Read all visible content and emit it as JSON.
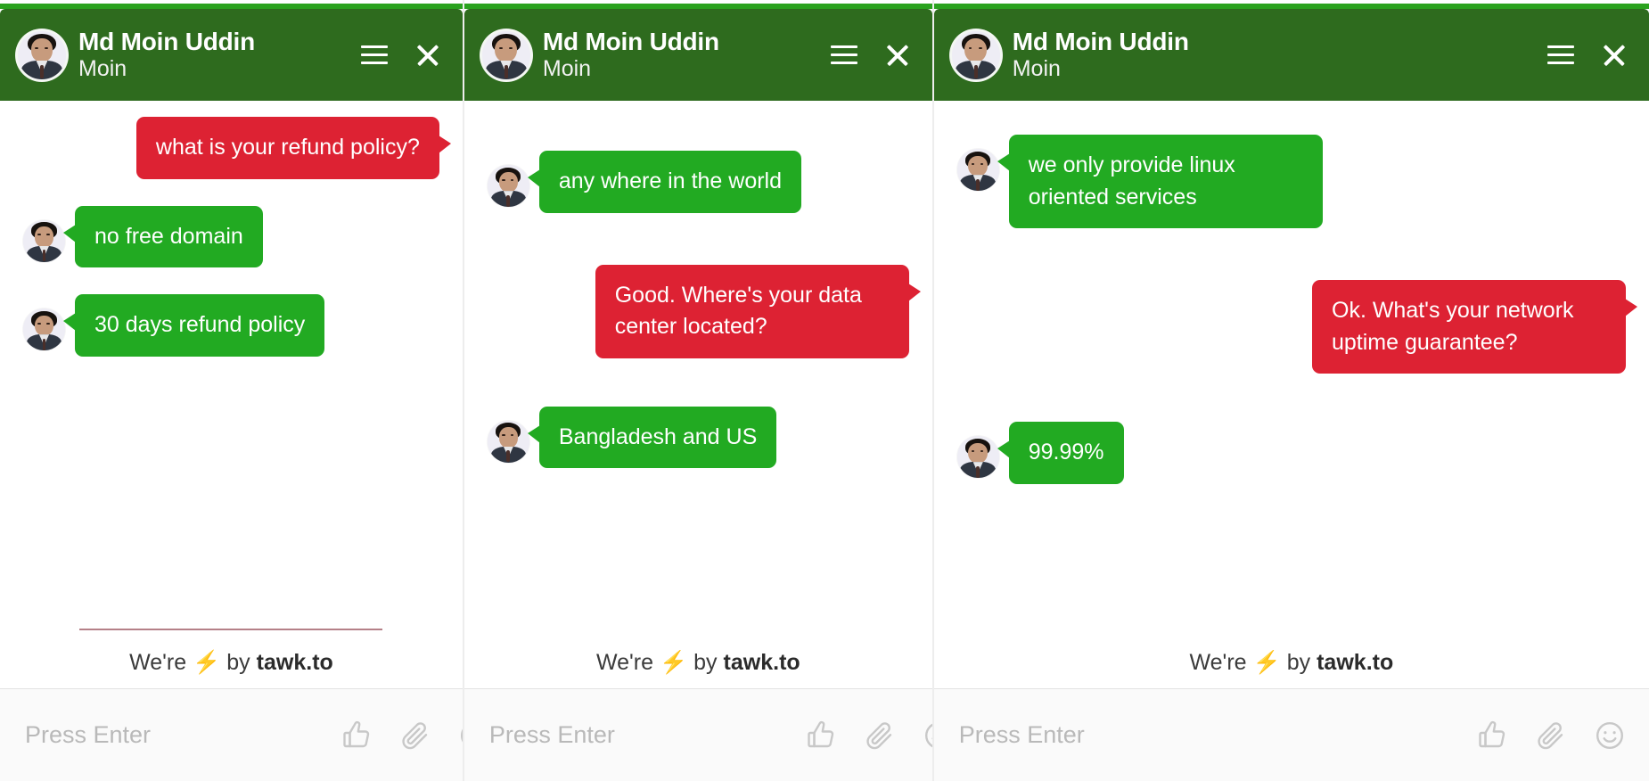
{
  "panels": [
    {
      "header": {
        "name": "Md Moin Uddin",
        "subtitle": "Moin",
        "menu_icon": "hamburger-menu-icon",
        "close_icon": "close-icon"
      },
      "messages": [
        {
          "sender": "visitor",
          "color": "red",
          "text": "what is your refund policy?"
        },
        {
          "sender": "agent",
          "color": "green",
          "text": "no free domain"
        },
        {
          "sender": "agent",
          "color": "green",
          "text": "30 days refund policy"
        }
      ],
      "branding": {
        "prefix": "We're",
        "bolt": "⚡",
        "middle": "by",
        "brand": "tawk.to"
      },
      "composer": {
        "placeholder": "Press Enter",
        "value": "",
        "icons": [
          "thumbs-up-icon",
          "paperclip-icon",
          "emoji-smiley-icon"
        ]
      }
    },
    {
      "header": {
        "name": "Md Moin Uddin",
        "subtitle": "Moin",
        "menu_icon": "hamburger-menu-icon",
        "close_icon": "close-icon"
      },
      "messages": [
        {
          "sender": "agent",
          "color": "green",
          "text": "any where in the world"
        },
        {
          "sender": "visitor",
          "color": "red",
          "text": "Good. Where's your data center located?"
        },
        {
          "sender": "agent",
          "color": "green",
          "text": "Bangladesh and US"
        }
      ],
      "branding": {
        "prefix": "We're",
        "bolt": "⚡",
        "middle": "by",
        "brand": "tawk.to"
      },
      "composer": {
        "placeholder": "Press Enter",
        "value": "",
        "icons": [
          "thumbs-up-icon",
          "paperclip-icon",
          "emoji-smiley-icon"
        ]
      }
    },
    {
      "header": {
        "name": "Md Moin Uddin",
        "subtitle": "Moin",
        "menu_icon": "hamburger-menu-icon",
        "close_icon": "close-icon"
      },
      "messages": [
        {
          "sender": "agent",
          "color": "green",
          "text": "we only provide linux oriented services"
        },
        {
          "sender": "visitor",
          "color": "red",
          "text": "Ok. What's your network uptime guarantee?"
        },
        {
          "sender": "agent",
          "color": "green",
          "text": "99.99%"
        }
      ],
      "branding": {
        "prefix": "We're",
        "bolt": "⚡",
        "middle": "by",
        "brand": "tawk.to"
      },
      "composer": {
        "placeholder": "Press Enter",
        "value": "",
        "icons": [
          "thumbs-up-icon",
          "paperclip-icon",
          "emoji-smiley-icon"
        ]
      }
    }
  ],
  "colors": {
    "header_green": "#2e6b1e",
    "agent_bubble_green": "#22aa22",
    "visitor_bubble_red": "#dd2233",
    "strip_green": "#2aa21e",
    "brand_bolt_yellow": "#f5c518",
    "placeholder_gray": "#b9b9b9"
  }
}
